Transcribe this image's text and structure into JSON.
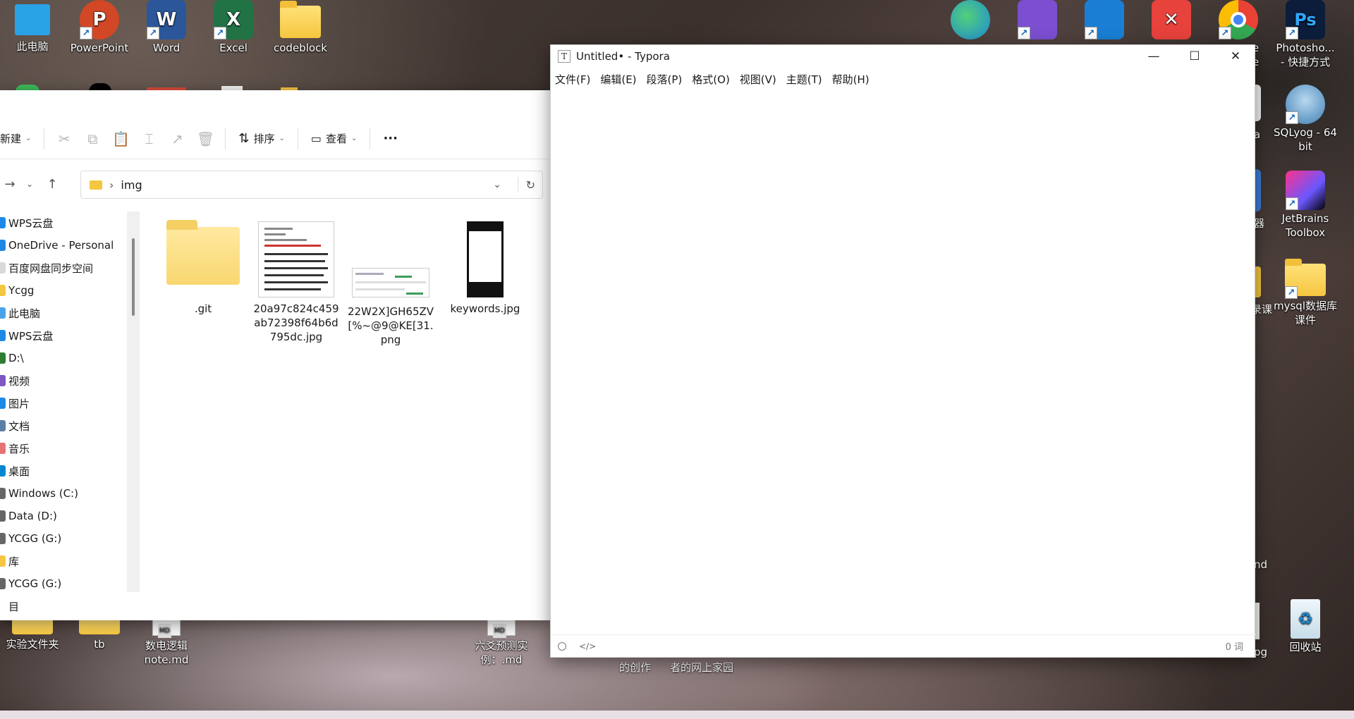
{
  "desktop_top_left": [
    {
      "label": "此电脑",
      "icon": "monitor-icon",
      "color": "#29a3e6"
    },
    {
      "label": "PowerPoint",
      "icon": "powerpoint-icon",
      "color": "#d24726",
      "letter": "P"
    },
    {
      "label": "Word",
      "icon": "word-icon",
      "color": "#2b579a",
      "letter": "W"
    },
    {
      "label": "Excel",
      "icon": "excel-icon",
      "color": "#217346",
      "letter": "X"
    },
    {
      "label": "codeblock",
      "icon": "folder-icon"
    }
  ],
  "desktop_top_right": [
    {
      "label": "",
      "icon": "edge-icon",
      "color": "#1e8ad6"
    },
    {
      "label": "",
      "icon": "visual-studio-icon",
      "color": "#7b4fd0"
    },
    {
      "label": "",
      "icon": "vscode-icon",
      "color": "#1a7fd4"
    },
    {
      "label": "",
      "icon": "xmind-icon",
      "color": "#e8423c"
    },
    {
      "label": "",
      "icon": "chrome-icon",
      "color": "#e8a93a"
    },
    {
      "label": "Photosho... - 快捷方式",
      "icon": "photoshop-icon",
      "color": "#0b1d3a",
      "letter": "Ps"
    }
  ],
  "desktop_right_column": [
    {
      "label": "SQLyog - 64 bit",
      "icon": "sqlyog-icon"
    },
    {
      "label": "JetBrains Toolbox",
      "icon": "jetbrains-toolbox-icon"
    },
    {
      "label": "mysql数据库课件",
      "icon": "folder-icon"
    },
    {
      "label": "回收站",
      "icon": "recycle-bin-icon"
    }
  ],
  "desktop_partial_labels": {
    "e_top": "e",
    "e_bottom": "e",
    "a": "a",
    "qi": "器",
    "kejk": "录课",
    "nd": "nd",
    "pg": "pg"
  },
  "desktop_bottom": [
    {
      "label": "实验文件夹",
      "icon": "folder-icon"
    },
    {
      "label": "tb",
      "icon": "folder-icon"
    },
    {
      "label": "数电逻辑note.md",
      "icon": "markdown-file-icon"
    },
    {
      "label": "六爻预测实例：.md",
      "icon": "markdown-file-icon"
    },
    {
      "label": "的创作",
      "icon": ""
    },
    {
      "label": "者的网上家园",
      "icon": ""
    }
  ],
  "explorer": {
    "toolbar": {
      "new_label": "新建",
      "sort_label": "排序",
      "view_label": "查看",
      "more_label": "···"
    },
    "address": {
      "path": "img"
    },
    "nav_items": [
      {
        "label": "WPS云盘",
        "color": "#1e88e5"
      },
      {
        "label": "OneDrive - Personal",
        "color": "#1e88e5"
      },
      {
        "label": "百度网盘同步空间",
        "color": "#d9d9d9"
      },
      {
        "label": "Ycgg",
        "color": "#f5c63f"
      },
      {
        "label": "此电脑",
        "color": "#4aa3e8"
      },
      {
        "label": "WPS云盘",
        "color": "#1e88e5"
      },
      {
        "label": "D:\\",
        "color": "#2e7d32"
      },
      {
        "label": "视频",
        "color": "#7e57c2"
      },
      {
        "label": "图片",
        "color": "#1e88e5"
      },
      {
        "label": "文档",
        "color": "#5c7fa8"
      },
      {
        "label": "音乐",
        "color": "#e57373"
      },
      {
        "label": "桌面",
        "color": "#0288d1"
      },
      {
        "label": "Windows (C:)",
        "color": "#666666"
      },
      {
        "label": "Data (D:)",
        "color": "#666666"
      },
      {
        "label": "YCGG (G:)",
        "color": "#666666"
      },
      {
        "label": "库",
        "color": "#f5c63f"
      },
      {
        "label": "YCGG (G:)",
        "color": "#666666"
      },
      {
        "label": "目",
        "color": "#ffffff"
      }
    ],
    "files": [
      {
        "name": ".git",
        "kind": "folder"
      },
      {
        "name": "20a97c824c459ab72398f64b6d795dc.jpg",
        "kind": "image-doc"
      },
      {
        "name": "22W2X]GH65ZV[%~@9@KE[31.png",
        "kind": "image-wide"
      },
      {
        "name": "keywords.jpg",
        "kind": "image-dark"
      }
    ]
  },
  "typora": {
    "title": "Untitled• - Typora",
    "logo": "T",
    "menu": [
      "文件(F)",
      "编辑(E)",
      "段落(P)",
      "格式(O)",
      "视图(V)",
      "主题(T)",
      "帮助(H)"
    ],
    "word_count": "0 词"
  }
}
